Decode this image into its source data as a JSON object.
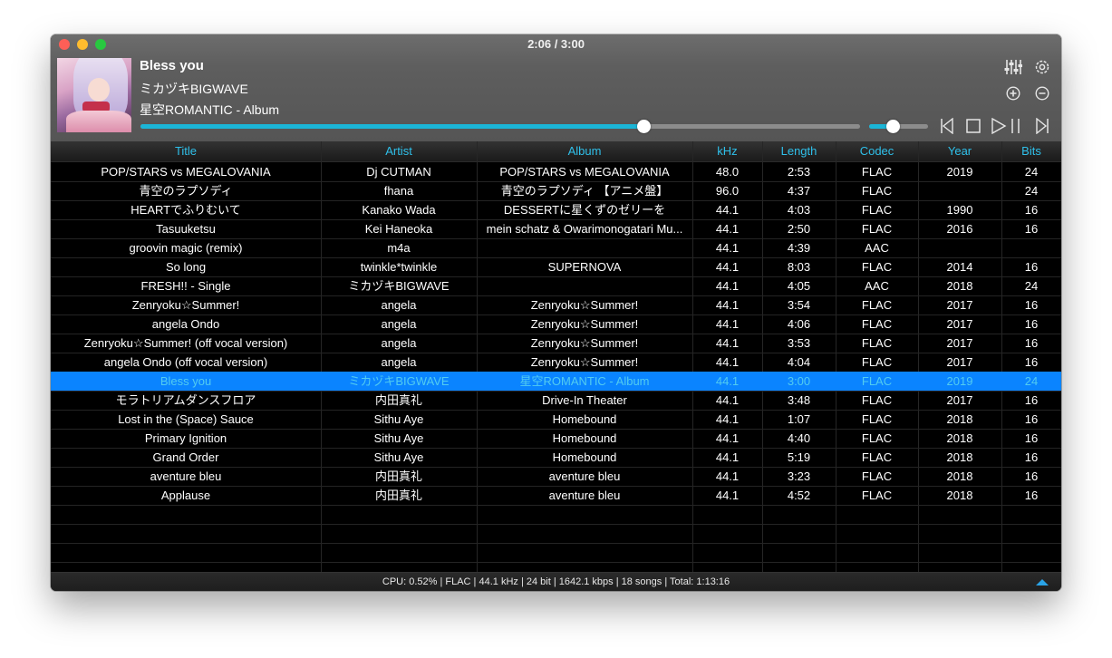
{
  "window": {
    "time_display": "2:06 / 3:00"
  },
  "now_playing": {
    "title": "Bless you",
    "artist": "ミカヅキBIGWAVE",
    "album": "星空ROMANTIC - Album",
    "progress_fraction": 0.7,
    "volume_fraction": 0.4
  },
  "columns": {
    "title": "Title",
    "artist": "Artist",
    "album": "Album",
    "khz": "kHz",
    "length": "Length",
    "codec": "Codec",
    "year": "Year",
    "bits": "Bits"
  },
  "tracks": [
    {
      "title": "POP/STARS vs MEGALOVANIA",
      "artist": "Dj CUTMAN",
      "album": "POP/STARS vs MEGALOVANIA",
      "khz": "48.0",
      "length": "2:53",
      "codec": "FLAC",
      "year": "2019",
      "bits": "24"
    },
    {
      "title": "青空のラプソディ",
      "artist": "fhana",
      "album": "青空のラプソディ 【アニメ盤】",
      "khz": "96.0",
      "length": "4:37",
      "codec": "FLAC",
      "year": "",
      "bits": "24"
    },
    {
      "title": "HEARTでふりむいて",
      "artist": "Kanako Wada",
      "album": "DESSERTに星くずのゼリーを",
      "khz": "44.1",
      "length": "4:03",
      "codec": "FLAC",
      "year": "1990",
      "bits": "16"
    },
    {
      "title": "Tasuuketsu",
      "artist": "Kei Haneoka",
      "album": "mein schatz & Owarimonogatari Mu...",
      "khz": "44.1",
      "length": "2:50",
      "codec": "FLAC",
      "year": "2016",
      "bits": "16"
    },
    {
      "title": "groovin magic (remix)",
      "artist": "m4a",
      "album": "",
      "khz": "44.1",
      "length": "4:39",
      "codec": "AAC",
      "year": "",
      "bits": ""
    },
    {
      "title": "So long",
      "artist": "twinkle*twinkle",
      "album": "SUPERNOVA",
      "khz": "44.1",
      "length": "8:03",
      "codec": "FLAC",
      "year": "2014",
      "bits": "16"
    },
    {
      "title": "FRESH!! - Single",
      "artist": "ミカヅキBIGWAVE",
      "album": "",
      "khz": "44.1",
      "length": "4:05",
      "codec": "AAC",
      "year": "2018",
      "bits": "24"
    },
    {
      "title": "Zenryoku☆Summer!",
      "artist": "angela",
      "album": "Zenryoku☆Summer!",
      "khz": "44.1",
      "length": "3:54",
      "codec": "FLAC",
      "year": "2017",
      "bits": "16"
    },
    {
      "title": "angela Ondo",
      "artist": "angela",
      "album": "Zenryoku☆Summer!",
      "khz": "44.1",
      "length": "4:06",
      "codec": "FLAC",
      "year": "2017",
      "bits": "16"
    },
    {
      "title": "Zenryoku☆Summer! (off vocal version)",
      "artist": "angela",
      "album": "Zenryoku☆Summer!",
      "khz": "44.1",
      "length": "3:53",
      "codec": "FLAC",
      "year": "2017",
      "bits": "16"
    },
    {
      "title": "angela Ondo (off vocal version)",
      "artist": "angela",
      "album": "Zenryoku☆Summer!",
      "khz": "44.1",
      "length": "4:04",
      "codec": "FLAC",
      "year": "2017",
      "bits": "16"
    },
    {
      "title": "Bless you",
      "artist": "ミカヅキBIGWAVE",
      "album": "星空ROMANTIC - Album",
      "khz": "44.1",
      "length": "3:00",
      "codec": "FLAC",
      "year": "2019",
      "bits": "24",
      "selected": true
    },
    {
      "title": "モラトリアムダンスフロア",
      "artist": "内田真礼",
      "album": "Drive-In Theater",
      "khz": "44.1",
      "length": "3:48",
      "codec": "FLAC",
      "year": "2017",
      "bits": "16"
    },
    {
      "title": "Lost in the (Space) Sauce",
      "artist": "Sithu Aye",
      "album": "Homebound",
      "khz": "44.1",
      "length": "1:07",
      "codec": "FLAC",
      "year": "2018",
      "bits": "16"
    },
    {
      "title": "Primary Ignition",
      "artist": "Sithu Aye",
      "album": "Homebound",
      "khz": "44.1",
      "length": "4:40",
      "codec": "FLAC",
      "year": "2018",
      "bits": "16"
    },
    {
      "title": "Grand Order",
      "artist": "Sithu Aye",
      "album": "Homebound",
      "khz": "44.1",
      "length": "5:19",
      "codec": "FLAC",
      "year": "2018",
      "bits": "16"
    },
    {
      "title": "aventure bleu",
      "artist": "内田真礼",
      "album": "aventure bleu",
      "khz": "44.1",
      "length": "3:23",
      "codec": "FLAC",
      "year": "2018",
      "bits": "16"
    },
    {
      "title": "Applause",
      "artist": "内田真礼",
      "album": "aventure bleu",
      "khz": "44.1",
      "length": "4:52",
      "codec": "FLAC",
      "year": "2018",
      "bits": "16"
    }
  ],
  "status": {
    "text": "CPU: 0.52% | FLAC | 44.1 kHz | 24 bit | 1642.1 kbps | 18 songs | Total: 1:13:16"
  },
  "icons": {
    "equalizer": "equalizer-icon",
    "settings": "gear-icon",
    "add": "plus-circle-icon",
    "remove": "minus-circle-icon",
    "previous": "previous-icon",
    "stop": "stop-icon",
    "play_pause": "play-pause-icon",
    "next": "next-icon",
    "toggle": "triangle-up-icon"
  },
  "colors": {
    "accent": "#1bb5d6",
    "header_text": "#2fc0ea",
    "selection": "#0a84ff",
    "selection_text": "#52ccf0"
  }
}
